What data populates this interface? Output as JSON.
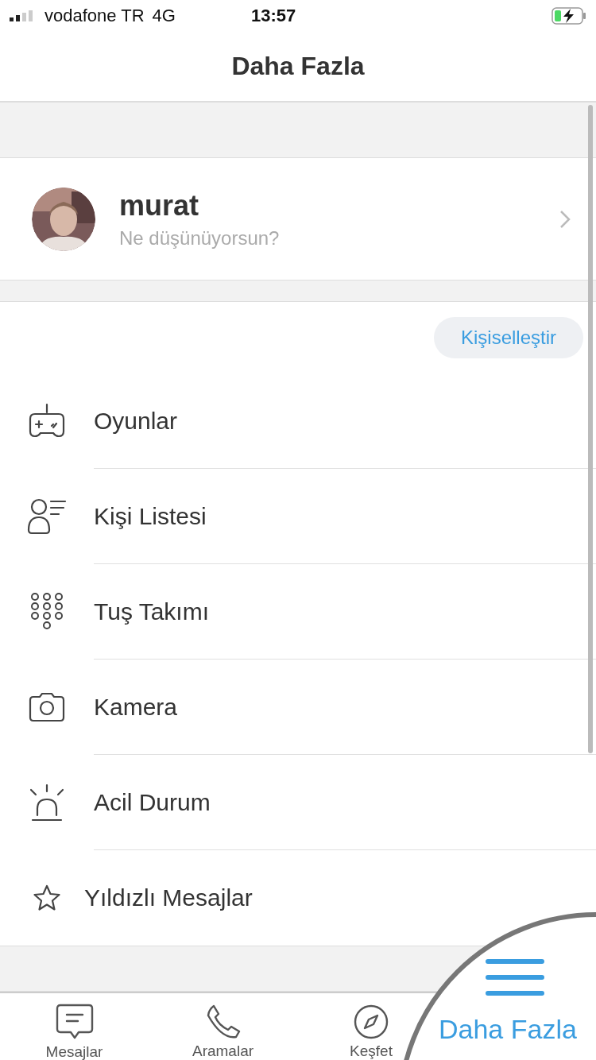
{
  "status_bar": {
    "carrier": "vodafone TR",
    "network": "4G",
    "time": "13:57"
  },
  "nav": {
    "title": "Daha Fazla"
  },
  "profile": {
    "name": "murat",
    "status": "Ne düşünüyorsun?"
  },
  "customize_button": "Kişiselleştir",
  "menu": [
    {
      "kind": "games",
      "label": "Oyunlar"
    },
    {
      "kind": "contacts",
      "label": "Kişi Listesi"
    },
    {
      "kind": "keypad",
      "label": "Tuş Takımı"
    },
    {
      "kind": "camera",
      "label": "Kamera"
    },
    {
      "kind": "emergency",
      "label": "Acil Durum"
    },
    {
      "kind": "star",
      "label": "Yıldızlı Mesajlar"
    }
  ],
  "tabs": [
    {
      "kind": "messages",
      "label": "Mesajlar",
      "selected": false
    },
    {
      "kind": "calls",
      "label": "Aramalar",
      "selected": false
    },
    {
      "kind": "explore",
      "label": "Keşfet",
      "selected": false
    },
    {
      "kind": "more",
      "label": "Daha Fazla",
      "selected": true
    }
  ]
}
